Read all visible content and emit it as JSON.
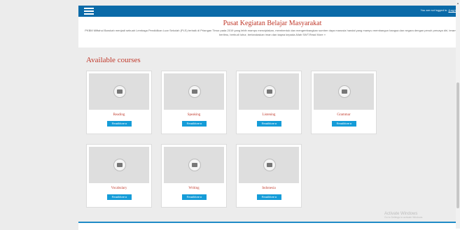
{
  "header": {
    "menu_icon": "hamburger-icon",
    "login_status": "You are not logged in.",
    "login_link": "(Log in)"
  },
  "banner": {
    "title": "Pusat Kegiatan Belajar Masyarakat",
    "description": "PKBM Miftahul Barokah menjadi sebuah Lembaga Pendidikan Luar Sekolah (PLS) terbaik di Priangan Timur pada 2019 yang lebih mampu menciptakan, membentuk dan mengembangkan sumber daya manusia handal yang mampu membangun bangsa dan negara dengan penuh percaya diri, terampil, berilmu, berbudi luhur, berlandaskan iman dan taqwa kepada Allah SWT.Read More »"
  },
  "courses": {
    "heading": "Available courses",
    "button_label": "ReadMore",
    "items": [
      {
        "name": "Reading"
      },
      {
        "name": "Speaking"
      },
      {
        "name": "Listening"
      },
      {
        "name": "Grammar"
      },
      {
        "name": "Vocabulary"
      },
      {
        "name": "Writing"
      },
      {
        "name": "Indonesia"
      }
    ]
  },
  "watermark": {
    "title": "Activate Windows",
    "subtitle": "Go to Settings to activate Windows."
  },
  "colors": {
    "topbar": "#0a6aa8",
    "accent_title": "#c0392b",
    "button": "#159cd8"
  }
}
